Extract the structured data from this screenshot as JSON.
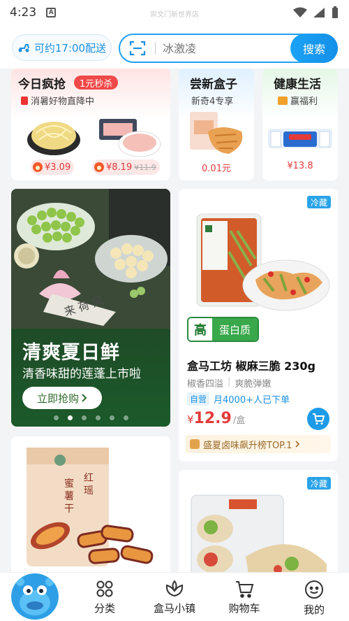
{
  "status_bar": {
    "time": "4:23",
    "location": "崇文门新世界店"
  },
  "header": {
    "delivery_label": "可约17:00配送",
    "search_placeholder": "冰激凌",
    "search_button": "搜索"
  },
  "promos": {
    "flash": {
      "title": "今日疯抢",
      "tag": "1元秒杀",
      "subtitle": "消暑好物直降中",
      "price1": "¥3.09",
      "price2": "¥8.19",
      "price2_old": "¥11.9"
    },
    "new_box": {
      "title": "尝新盒子",
      "subtitle": "新奇4专享",
      "price": "0.01元"
    },
    "health": {
      "title": "健康生活",
      "subtitle": "赢福利",
      "price": "¥13.8"
    }
  },
  "banner": {
    "title": "清爽夏日鲜",
    "subtitle": "清香味甜的莲蓬上市啦",
    "button_label": "立即抢购",
    "dot_count": 6,
    "active_dot": 1
  },
  "product": {
    "cold_tag": "冷藏",
    "badge_hi": "高",
    "badge_text": "蛋白质",
    "name": "盒马工坊 椒麻三脆 230g",
    "tags": [
      "椒香四溢",
      "爽脆弹嫩"
    ],
    "self_tag": "自营",
    "sales": "月4000+人已下单",
    "price_symbol": "¥",
    "price": "12.9",
    "unit": "/盒",
    "rank": "盛夏卤味飙升榜TOP.1"
  },
  "lower": {
    "right_cold_tag": "冷藏"
  },
  "nav": {
    "items": [
      {
        "label": "分类"
      },
      {
        "label": "盒马小镇"
      },
      {
        "label": "购物车"
      },
      {
        "label": "我的"
      }
    ]
  },
  "colors": {
    "accent": "#1e9be8",
    "price_red": "#e33a3a",
    "green": "#39a84b"
  }
}
